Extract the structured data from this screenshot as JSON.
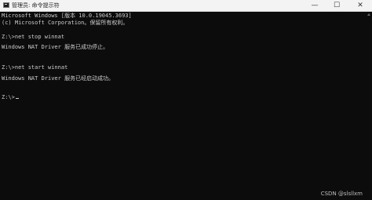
{
  "window": {
    "title": "管理员: 命令提示符",
    "icon": "cmd-icon",
    "controls": {
      "minimize": "—",
      "maximize": "☐",
      "close": "✕"
    }
  },
  "console": {
    "lines": [
      "Microsoft Windows [版本 10.0.19045.3693]",
      "(c) Microsoft Corporation。保留所有权利。",
      "",
      "Z:\\>net stop winnat",
      "",
      "Windows NAT Driver 服务已成功停止。",
      "",
      "",
      "Z:\\>net start winnat",
      "",
      "Windows NAT Driver 服务已经启动成功。",
      "",
      "",
      "Z:\\>"
    ]
  },
  "watermark": "CSDN @slsllxm",
  "colors": {
    "background": "#0c0c0c",
    "text": "#cccccc",
    "titlebar": "#f3f3f3"
  }
}
